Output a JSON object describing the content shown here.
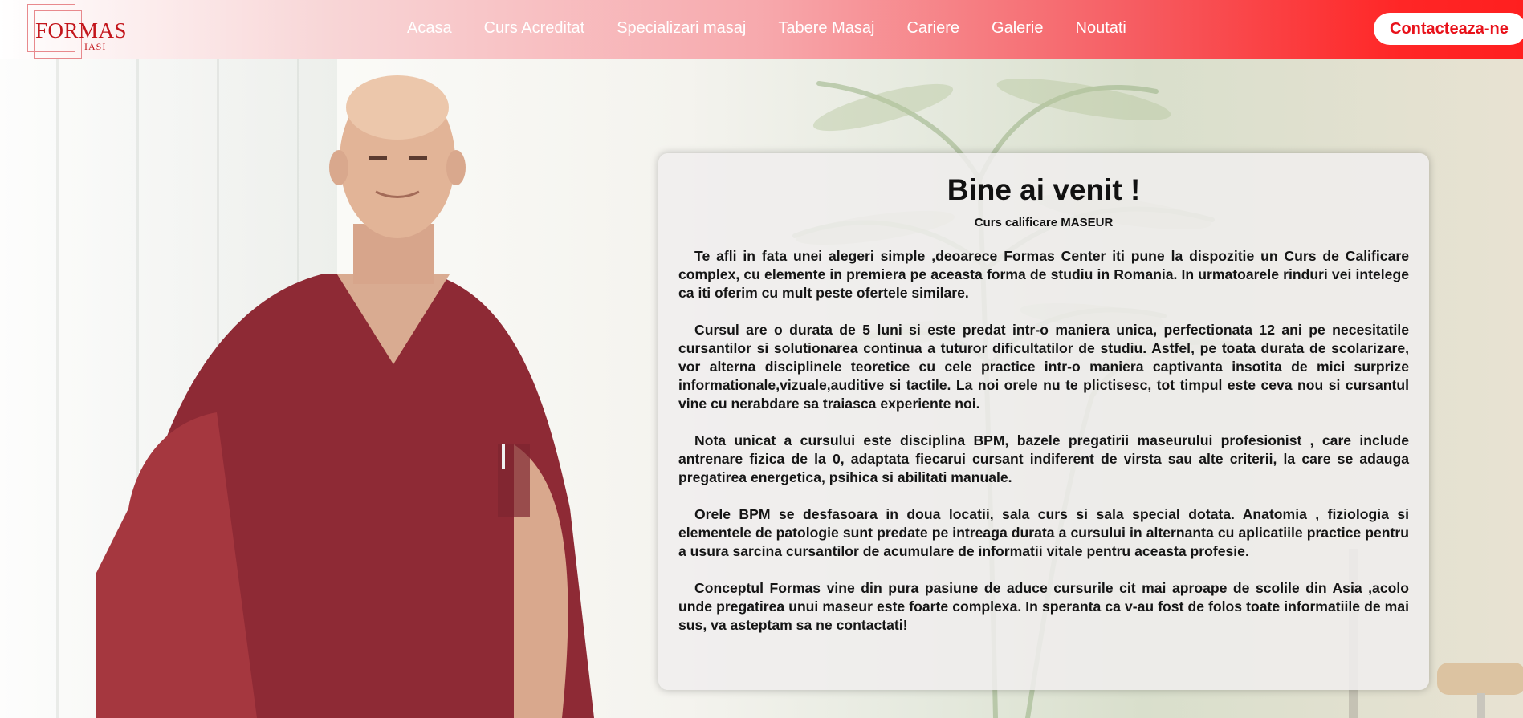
{
  "header": {
    "logo": {
      "wordmark": "FORMAS",
      "city": "IASI"
    },
    "nav": [
      {
        "label": "Acasa"
      },
      {
        "label": "Curs Acreditat"
      },
      {
        "label": "Specializari masaj"
      },
      {
        "label": "Tabere Masaj"
      },
      {
        "label": "Cariere"
      },
      {
        "label": "Galerie"
      },
      {
        "label": "Noutati"
      }
    ],
    "cta_label": "Contacteaza-ne"
  },
  "colors": {
    "accent": "#ff2626",
    "cta_text": "#e8111a",
    "logo": "#c3151b",
    "scrubs": "#8e2a35"
  },
  "hero": {
    "image_icon": "instructor-photo",
    "card": {
      "title": "Bine ai venit !",
      "subtitle": "Curs calificare MASEUR",
      "paragraphs": [
        "Te afli in fata unei alegeri simple ,deoarece Formas Center iti pune la dispozitie un Curs de Calificare complex, cu elemente in premiera pe aceasta forma de studiu in Romania. In urmatoarele rinduri vei intelege ca iti oferim cu mult peste ofertele similare.",
        "Cursul are o durata de 5 luni si este predat intr-o maniera unica, perfectionata 12 ani pe necesitatile cursantilor si solutionarea continua a tuturor dificultatilor de studiu. Astfel, pe toata durata de scolarizare, vor alterna disciplinele teoretice cu cele practice intr-o maniera captivanta insotita de mici surprize informationale,vizuale,auditive si tactile. La noi orele nu te plictisesc, tot timpul este ceva nou si cursantul vine cu nerabdare sa traiasca experiente noi.",
        "Nota unicat a cursului este disciplina BPM, bazele pregatirii maseurului profesionist , care include antrenare fizica de la 0, adaptata fiecarui cursant indiferent de virsta sau alte criterii, la care se adauga pregatirea energetica, psihica si abilitati manuale.",
        "Orele BPM se desfasoara in doua locatii, sala curs si sala special dotata. Anatomia , fiziologia si elementele de patologie sunt predate pe intreaga durata a cursului in alternanta cu aplicatiile practice pentru a usura sarcina cursantilor de acumulare de informatii vitale pentru aceasta profesie.",
        "Conceptul Formas vine din pura pasiune de aduce cursurile cit mai aproape de scolile din Asia ,acolo unde pregatirea unui maseur este foarte complexa. In speranta ca v-au fost de folos toate informatiile de mai sus, va asteptam sa ne contactati!"
      ]
    }
  }
}
